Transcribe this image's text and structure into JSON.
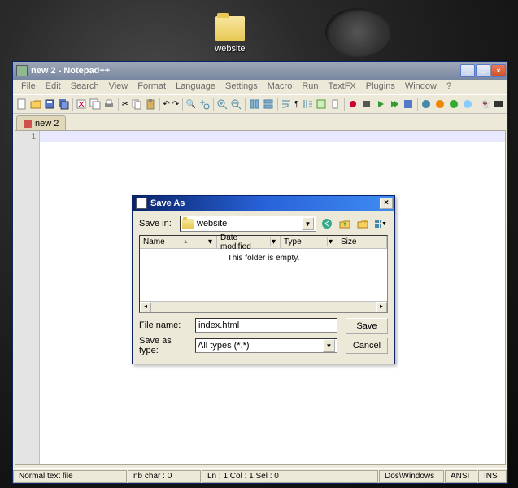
{
  "desktop": {
    "folder_label": "website"
  },
  "npp": {
    "title": "new 2 - Notepad++",
    "menu": [
      "File",
      "Edit",
      "Search",
      "View",
      "Format",
      "Language",
      "Settings",
      "Macro",
      "Run",
      "TextFX",
      "Plugins",
      "Window",
      "?"
    ],
    "tab_label": "new 2",
    "gutter_line": "1",
    "status": {
      "filetype": "Normal text file",
      "nbchar": "nb char : 0",
      "pos": "Ln : 1  Col : 1  Sel : 0",
      "eol": "Dos\\Windows",
      "enc": "ANSI",
      "mode": "INS"
    }
  },
  "saveas": {
    "title": "Save As",
    "savein_label": "Save in:",
    "savein_value": "website",
    "columns": {
      "name": "Name",
      "date": "Date modified",
      "type": "Type",
      "size": "Size"
    },
    "empty_text": "This folder is empty.",
    "filename_label": "File name:",
    "filename_value": "index.html",
    "type_label": "Save as type:",
    "type_value": "All types (*.*)",
    "save_btn": "Save",
    "cancel_btn": "Cancel"
  }
}
